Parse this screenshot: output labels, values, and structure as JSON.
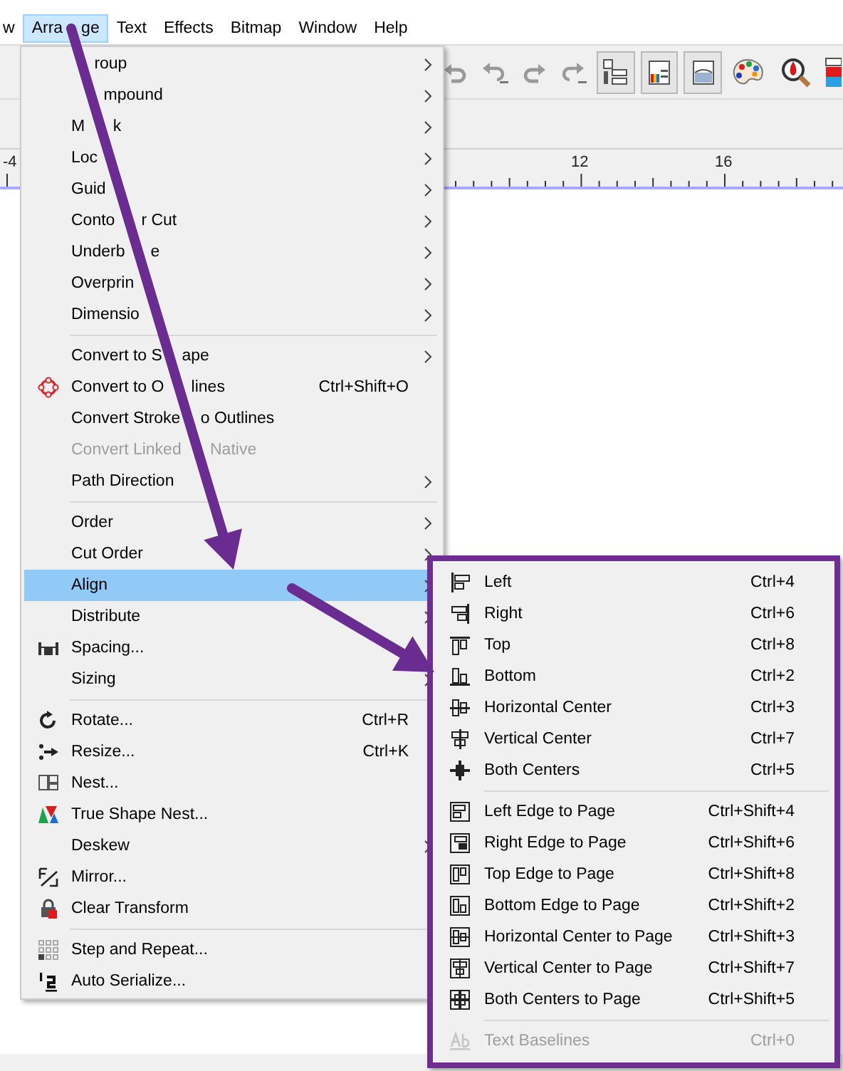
{
  "menubar": [
    {
      "label": "w",
      "selected": false
    },
    {
      "label_parts": {
        "before": "Arra",
        "after": "ge"
      },
      "selected": true
    },
    {
      "label": "Text",
      "selected": false
    },
    {
      "label": "Effects",
      "selected": false
    },
    {
      "label": "Bitmap",
      "selected": false
    },
    {
      "label": "Window",
      "selected": false
    },
    {
      "label": "Help",
      "selected": false
    }
  ],
  "ruler": {
    "labels": [
      "-4",
      "12",
      "16"
    ]
  },
  "arrange_menu": {
    "items": [
      {
        "kind": "item",
        "label_parts": {
          "after": "roup"
        },
        "submenu": true,
        "disabled": false,
        "selected": false,
        "icon": false
      },
      {
        "kind": "item",
        "label_parts": {
          "after": "mpound"
        },
        "submenu": true,
        "disabled": false,
        "selected": false,
        "icon": false
      },
      {
        "kind": "item",
        "label_parts": {
          "before": "M",
          "after": "k"
        },
        "submenu": true,
        "disabled": false,
        "selected": false,
        "icon": false
      },
      {
        "kind": "item",
        "label_parts": {
          "before": "Loc"
        },
        "submenu": true,
        "disabled": false,
        "selected": false,
        "icon": false
      },
      {
        "kind": "item",
        "label_parts": {
          "before": "Guid"
        },
        "submenu": true,
        "disabled": false,
        "selected": false,
        "icon": false
      },
      {
        "kind": "item",
        "label_parts": {
          "before": "Conto",
          "after": "r Cut"
        },
        "submenu": true,
        "disabled": false,
        "selected": false,
        "icon": false
      },
      {
        "kind": "item",
        "label_parts": {
          "before": "Underb",
          "after": "e"
        },
        "submenu": true,
        "disabled": false,
        "selected": false,
        "icon": false
      },
      {
        "kind": "item",
        "label_parts": {
          "before": "Overprin"
        },
        "submenu": true,
        "disabled": false,
        "selected": false,
        "icon": false
      },
      {
        "kind": "item",
        "label_parts": {
          "before": "Dimensio"
        },
        "submenu": true,
        "disabled": false,
        "selected": false,
        "icon": false
      },
      {
        "kind": "separator"
      },
      {
        "kind": "item",
        "label_parts": {
          "before": "Convert to S",
          "after": "ape"
        },
        "submenu": true,
        "disabled": false,
        "selected": false,
        "icon": false
      },
      {
        "kind": "item",
        "label_parts": {
          "before": "Convert to O",
          "after": "lines"
        },
        "shortcut": "Ctrl+Shift+O",
        "submenu": false,
        "disabled": false,
        "selected": false,
        "icon": true
      },
      {
        "kind": "item",
        "label_parts": {
          "before": "Convert Stroke",
          "after": "o Outlines"
        },
        "submenu": false,
        "disabled": false,
        "selected": false,
        "icon": false
      },
      {
        "kind": "item",
        "label_parts": {
          "before": "Convert Linked",
          "after": "Native"
        },
        "submenu": false,
        "disabled": true,
        "selected": false,
        "icon": false
      },
      {
        "kind": "item",
        "label": "Path Direction",
        "submenu": true,
        "disabled": false,
        "selected": false,
        "icon": false
      },
      {
        "kind": "separator"
      },
      {
        "kind": "item",
        "label": "Order",
        "submenu": true,
        "disabled": false,
        "selected": false,
        "icon": false
      },
      {
        "kind": "item",
        "label": "Cut Order",
        "submenu": true,
        "disabled": false,
        "selected": false,
        "icon": false
      },
      {
        "kind": "item",
        "label": "Align",
        "submenu": true,
        "disabled": false,
        "selected": true,
        "icon": false
      },
      {
        "kind": "item",
        "label": "Distribute",
        "submenu": true,
        "disabled": false,
        "selected": false,
        "icon": false
      },
      {
        "kind": "item",
        "label": "Spacing...",
        "submenu": false,
        "disabled": false,
        "selected": false,
        "icon": true
      },
      {
        "kind": "item",
        "label": "Sizing",
        "submenu": true,
        "disabled": false,
        "selected": false,
        "icon": false
      },
      {
        "kind": "separator"
      },
      {
        "kind": "item",
        "label": "Rotate...",
        "shortcut": "Ctrl+R",
        "submenu": false,
        "disabled": false,
        "selected": false,
        "icon": true
      },
      {
        "kind": "item",
        "label": "Resize...",
        "shortcut": "Ctrl+K",
        "submenu": false,
        "disabled": false,
        "selected": false,
        "icon": true
      },
      {
        "kind": "item",
        "label": "Nest...",
        "submenu": false,
        "disabled": false,
        "selected": false,
        "icon": true
      },
      {
        "kind": "item",
        "label": "True Shape Nest...",
        "submenu": false,
        "disabled": false,
        "selected": false,
        "icon": true
      },
      {
        "kind": "item",
        "label": "Deskew",
        "submenu": true,
        "disabled": false,
        "selected": false,
        "icon": false
      },
      {
        "kind": "item",
        "label": "Mirror...",
        "submenu": false,
        "disabled": false,
        "selected": false,
        "icon": true
      },
      {
        "kind": "item",
        "label": "Clear Transform",
        "submenu": false,
        "disabled": false,
        "selected": false,
        "icon": true
      },
      {
        "kind": "separator"
      },
      {
        "kind": "item",
        "label": "Step and Repeat...",
        "submenu": false,
        "disabled": false,
        "selected": false,
        "icon": true
      },
      {
        "kind": "item",
        "label": "Auto Serialize...",
        "submenu": false,
        "disabled": false,
        "selected": false,
        "icon": true
      }
    ]
  },
  "align_submenu": {
    "items": [
      {
        "kind": "item",
        "label": "Left",
        "shortcut": "Ctrl+4",
        "disabled": false,
        "selected": false,
        "icon": true
      },
      {
        "kind": "item",
        "label": "Right",
        "shortcut": "Ctrl+6",
        "disabled": false,
        "selected": false,
        "icon": true
      },
      {
        "kind": "item",
        "label": "Top",
        "shortcut": "Ctrl+8",
        "disabled": false,
        "selected": false,
        "icon": true
      },
      {
        "kind": "item",
        "label": "Bottom",
        "shortcut": "Ctrl+2",
        "disabled": false,
        "selected": false,
        "icon": true
      },
      {
        "kind": "item",
        "label": "Horizontal Center",
        "shortcut": "Ctrl+3",
        "disabled": false,
        "selected": false,
        "icon": true
      },
      {
        "kind": "item",
        "label": "Vertical Center",
        "shortcut": "Ctrl+7",
        "disabled": false,
        "selected": false,
        "icon": true
      },
      {
        "kind": "item",
        "label": "Both Centers",
        "shortcut": "Ctrl+5",
        "disabled": false,
        "selected": false,
        "icon": true
      },
      {
        "kind": "separator"
      },
      {
        "kind": "item",
        "label": "Left Edge to Page",
        "shortcut": "Ctrl+Shift+4",
        "disabled": false,
        "selected": false,
        "icon": true
      },
      {
        "kind": "item",
        "label": "Right Edge to Page",
        "shortcut": "Ctrl+Shift+6",
        "disabled": false,
        "selected": false,
        "icon": true
      },
      {
        "kind": "item",
        "label": "Top Edge to Page",
        "shortcut": "Ctrl+Shift+8",
        "disabled": false,
        "selected": false,
        "icon": true
      },
      {
        "kind": "item",
        "label": "Bottom Edge to Page",
        "shortcut": "Ctrl+Shift+2",
        "disabled": false,
        "selected": false,
        "icon": true
      },
      {
        "kind": "item",
        "label": "Horizontal Center to Page",
        "shortcut": "Ctrl+Shift+3",
        "disabled": false,
        "selected": false,
        "icon": true
      },
      {
        "kind": "item",
        "label": "Vertical Center to Page",
        "shortcut": "Ctrl+Shift+7",
        "disabled": false,
        "selected": false,
        "icon": true
      },
      {
        "kind": "item",
        "label": "Both Centers to Page",
        "shortcut": "Ctrl+Shift+5",
        "disabled": false,
        "selected": false,
        "icon": true
      },
      {
        "kind": "separator"
      },
      {
        "kind": "item",
        "label": "Text Baselines",
        "shortcut": "Ctrl+0",
        "disabled": true,
        "selected": false,
        "icon": true
      }
    ]
  }
}
